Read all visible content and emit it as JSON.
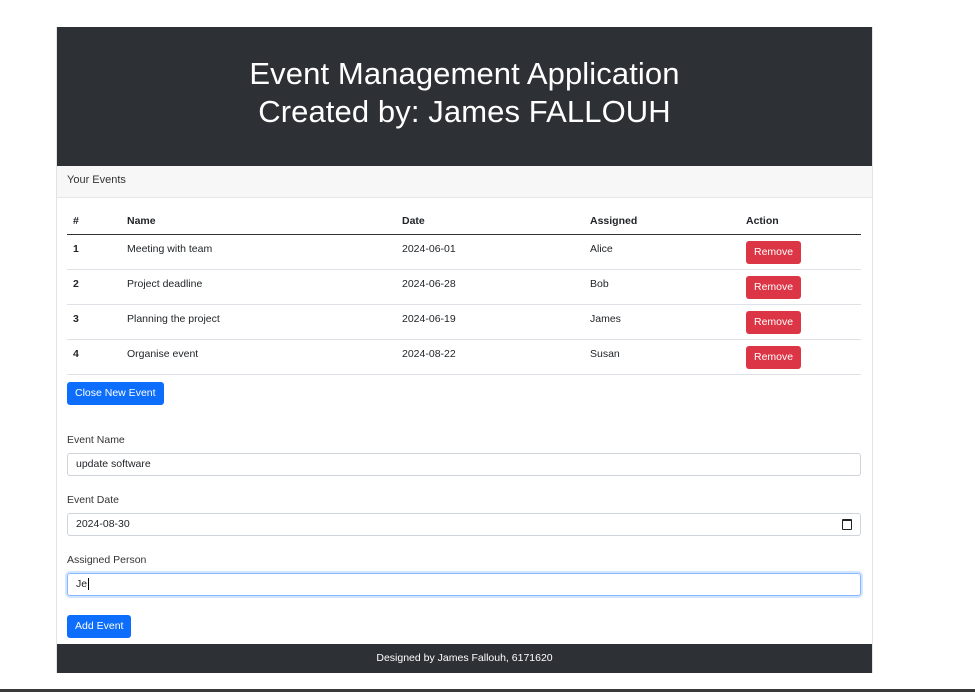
{
  "header": {
    "title_line1": "Event Management Application",
    "title_line2": "Created by: James FALLOUH"
  },
  "card": {
    "header": "Your Events"
  },
  "table": {
    "columns": [
      "#",
      "Name",
      "Date",
      "Assigned",
      "Action"
    ],
    "rows": [
      {
        "idx": "1",
        "name": "Meeting with team",
        "date": "2024-06-01",
        "assigned": "Alice",
        "action": "Remove"
      },
      {
        "idx": "2",
        "name": "Project deadline",
        "date": "2024-06-28",
        "assigned": "Bob",
        "action": "Remove"
      },
      {
        "idx": "3",
        "name": "Planning the project",
        "date": "2024-06-19",
        "assigned": "James",
        "action": "Remove"
      },
      {
        "idx": "4",
        "name": "Organise event",
        "date": "2024-08-22",
        "assigned": "Susan",
        "action": "Remove"
      }
    ]
  },
  "toggle_button": "Close New Event",
  "form": {
    "event_name_label": "Event Name",
    "event_name_value": "update software",
    "event_date_label": "Event Date",
    "event_date_value": "2024-08-30",
    "assigned_label": "Assigned Person",
    "assigned_value": "Je",
    "submit": "Add Event"
  },
  "footer": "Designed by James Fallouh, 6171620",
  "colors": {
    "header_bg": "#2d3035",
    "danger": "#dc3545",
    "primary": "#0d6efd"
  },
  "icons": {
    "date_picker": "calendar-icon"
  }
}
